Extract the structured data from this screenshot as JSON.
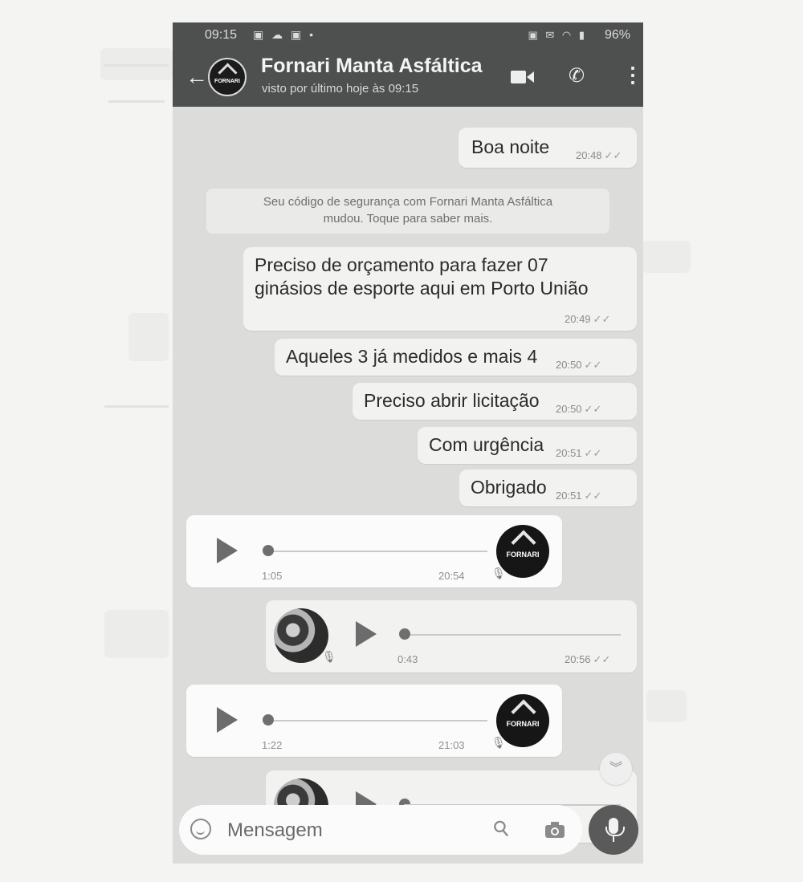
{
  "status_bar": {
    "time": "09:15",
    "left_icons": "▣ ☁ ▣ •",
    "right_icons": "▣ ✉ ◠ ▮",
    "battery": "96%"
  },
  "header": {
    "contact_name": "Fornari Manta Asfáltica",
    "last_seen": "visto por último hoje às 09:15",
    "avatar_text": "FORNARI"
  },
  "messages": [
    {
      "text": "Boa noite",
      "time": "20:48",
      "ticks": "✓✓"
    },
    {
      "text_line1": "Preciso de orçamento para fazer 07",
      "text_line2": "ginásios de esporte aqui em Porto União",
      "time": "20:49",
      "ticks": "✓✓"
    },
    {
      "text": "Aqueles 3 já medidos e mais 4",
      "time": "20:50",
      "ticks": "✓✓"
    },
    {
      "text": "Preciso abrir licitação",
      "time": "20:50",
      "ticks": "✓✓"
    },
    {
      "text": "Com urgência",
      "time": "20:51",
      "ticks": "✓✓"
    },
    {
      "text": "Obrigado",
      "time": "20:51",
      "ticks": "✓✓"
    }
  ],
  "system_note": {
    "line1": "Seu código de segurança com Fornari Manta Asfáltica",
    "line2": "mudou. Toque para saber mais."
  },
  "audio_messages": [
    {
      "direction": "in",
      "duration": "1:05",
      "time": "20:54"
    },
    {
      "direction": "out",
      "duration": "0:43",
      "time": "20:56",
      "ticks": "✓✓"
    },
    {
      "direction": "in",
      "duration": "1:22",
      "time": "21:03"
    }
  ],
  "composer": {
    "placeholder": "Mensagem"
  },
  "icons": {
    "back": "back-arrow-icon",
    "video": "video-camera-icon",
    "call": "phone-icon",
    "menu": "more-vertical-icon",
    "emoji": "emoji-icon",
    "attach": "paperclip-icon",
    "camera": "camera-icon",
    "mic": "microphone-icon",
    "scroll": "double-chevron-down-icon"
  },
  "colors": {
    "header": "#4e4f4f",
    "chat_background": "#dcdcdb",
    "outgoing_bubble": "#f2f2f1",
    "incoming_bubble": "#fbfbfb",
    "mic_button": "#5a5a5a"
  }
}
